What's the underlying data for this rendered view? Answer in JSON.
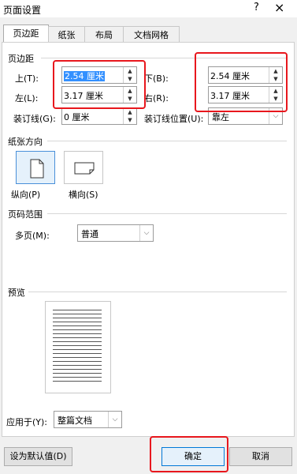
{
  "window": {
    "title": "页面设置",
    "help": "?",
    "close": "×"
  },
  "tabs": [
    {
      "label": "页边距",
      "active": true
    },
    {
      "label": "纸张"
    },
    {
      "label": "布局"
    },
    {
      "label": "文档网格"
    }
  ],
  "margins": {
    "section": "页边距",
    "top": {
      "label": "上(T):",
      "value": "2.54 厘米"
    },
    "bottom": {
      "label": "下(B):",
      "value": "2.54 厘米"
    },
    "left": {
      "label": "左(L):",
      "value": "3.17 厘米"
    },
    "right": {
      "label": "右(R):",
      "value": "3.17 厘米"
    },
    "gutter": {
      "label": "装订线(G):",
      "value": "0 厘米"
    },
    "gutter_pos": {
      "label": "装订线位置(U):",
      "value": "靠左"
    }
  },
  "orientation": {
    "section": "纸张方向",
    "portrait": "纵向(P)",
    "landscape": "横向(S)"
  },
  "pages": {
    "section": "页码范围",
    "multi_label": "多页(M):",
    "multi_value": "普通"
  },
  "preview": {
    "section": "预览"
  },
  "apply": {
    "label": "应用于(Y):",
    "value": "整篇文档"
  },
  "buttons": {
    "default": "设为默认值(D)",
    "ok": "确定",
    "cancel": "取消"
  },
  "colors": {
    "highlight": "#e8171d",
    "accent": "#0078d7"
  }
}
